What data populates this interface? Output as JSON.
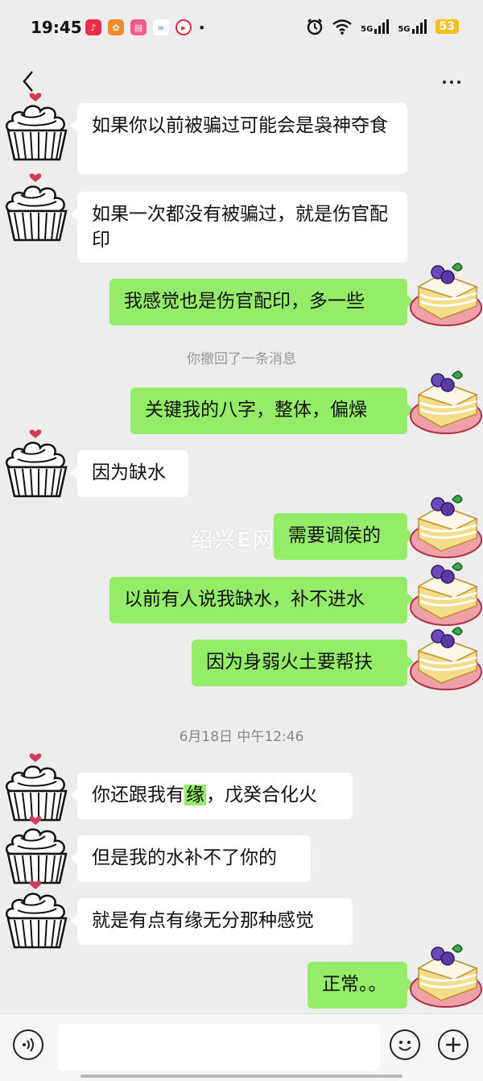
{
  "status_bar": {
    "time": "19:45",
    "app_icons": [
      "music-app-icon",
      "game-app-icon",
      "video-app-icon",
      "cloud-app-icon",
      "player-app-icon"
    ],
    "dot": "•",
    "signal_1": "5G",
    "signal_2": "5G",
    "battery": "53"
  },
  "header": {
    "back_icon": "chevron-left-icon",
    "more_icon": "more-dots-icon"
  },
  "messages": [
    {
      "side": "left",
      "text": "如果你以前被骗过可能会是袅神夺食"
    },
    {
      "side": "left",
      "text": "如果一次都没有被骗过，就是伤官配印"
    },
    {
      "side": "right",
      "text": "我感觉也是伤官配印，多一些"
    },
    {
      "side": "system",
      "text": "你撤回了一条消息"
    },
    {
      "side": "right",
      "text": "关键我的八字，整体，偏燥"
    },
    {
      "side": "left",
      "text": "因为缺水"
    },
    {
      "side": "right",
      "text": "需要调侯的"
    },
    {
      "side": "right",
      "text": "以前有人说我缺水，补不进水"
    },
    {
      "side": "right",
      "text": "因为身弱火土要帮扶"
    },
    {
      "side": "system",
      "text": "6月18日 中午12:46"
    },
    {
      "side": "left",
      "text_before": "你还跟我有",
      "text_highlight": "缘",
      "text_after": "，戊癸合化火"
    },
    {
      "side": "left",
      "text": "但是我的水补不了你的"
    },
    {
      "side": "left",
      "text": "就是有点有缘无分那种感觉"
    },
    {
      "side": "right",
      "text": "正常。。"
    }
  ],
  "watermark": "绍兴E网",
  "colors": {
    "background": "#ededed",
    "sent_bubble": "#95ec69",
    "received_bubble": "#ffffff"
  },
  "input_bar": {
    "voice_icon": "voice-icon",
    "emoji_icon": "emoji-icon",
    "plus_icon": "plus-icon"
  }
}
